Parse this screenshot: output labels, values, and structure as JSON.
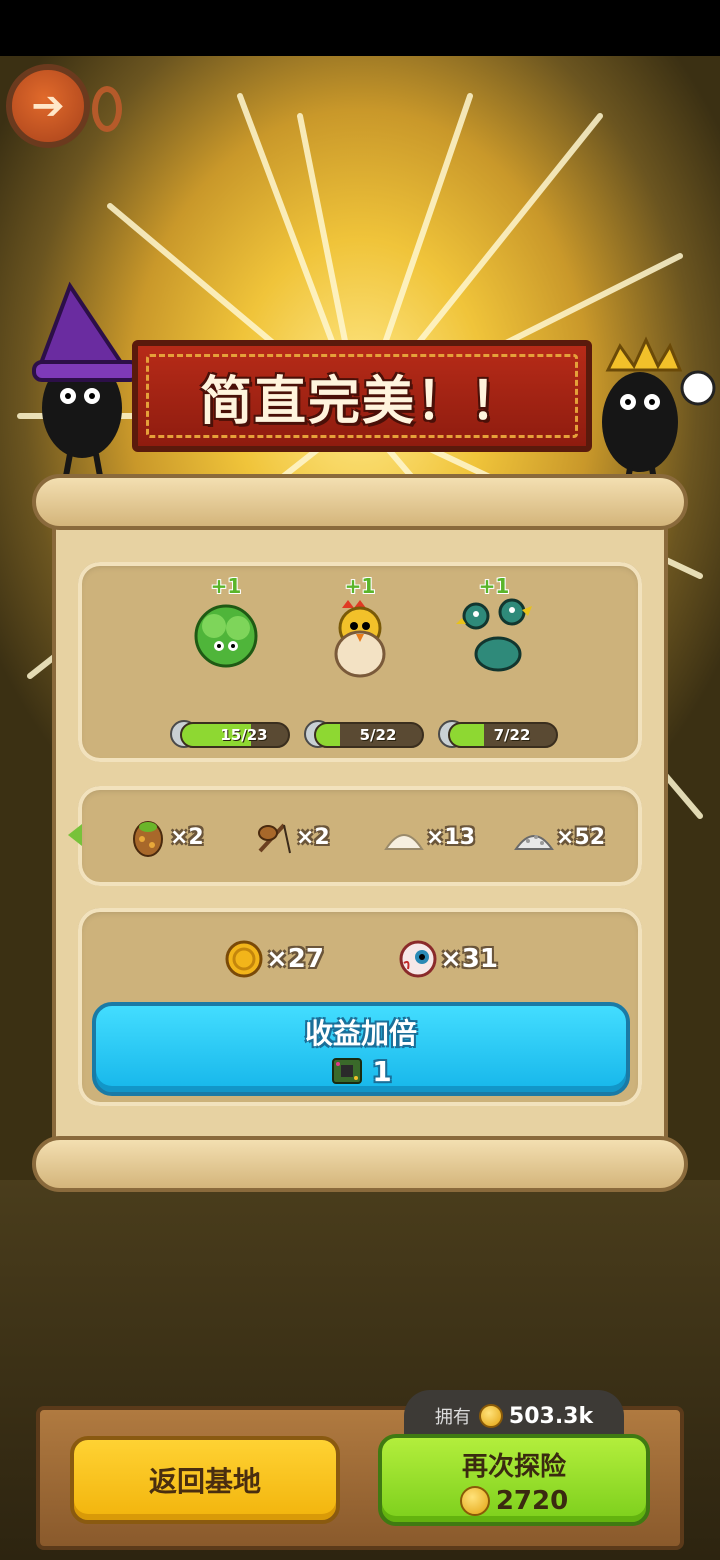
{
  "header": {
    "back_icon": "back-arrow-icon"
  },
  "banner": {
    "title": "简直完美！！"
  },
  "pets": [
    {
      "name_icon": "lettuce-creature-icon",
      "gain": "+1",
      "progress_text": "15/23",
      "progress": 0.652,
      "color": "#4fb53a"
    },
    {
      "name_icon": "hatching-chick-icon",
      "gain": "+1",
      "progress_text": "5/22",
      "progress": 0.227,
      "color": "#f2c12a"
    },
    {
      "name_icon": "two-headed-ostrich-icon",
      "gain": "+1",
      "progress_text": "7/22",
      "progress": 0.318,
      "color": "#2f8a7a"
    }
  ],
  "items": [
    {
      "icon": "spotted-egg-icon",
      "count": "×2"
    },
    {
      "icon": "slingshot-icon",
      "count": "×2"
    },
    {
      "icon": "flour-pile-icon",
      "count": "×13"
    },
    {
      "icon": "rice-pile-icon",
      "count": "×52"
    }
  ],
  "rewards": [
    {
      "icon": "gold-coin-icon",
      "count": "×27"
    },
    {
      "icon": "eyeball-icon",
      "count": "×31"
    }
  ],
  "double_button": {
    "label": "收益加倍",
    "cost_icon": "circuit-chip-icon",
    "cost": "1"
  },
  "owned": {
    "label": "拥有",
    "icon": "gold-coin-icon",
    "value": "503.3k"
  },
  "buttons": {
    "return_home": "返回基地",
    "explore_again": "再次探险",
    "explore_cost": "2720"
  },
  "colors": {
    "accent_blue": "#1fc3f2",
    "accent_green": "#8ed832",
    "accent_yellow": "#ffc61e",
    "banner_red": "#b72b18"
  }
}
